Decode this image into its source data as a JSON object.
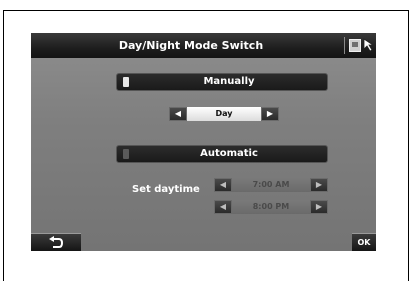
{
  "header": {
    "title": "Day/Night Mode Switch",
    "screen_icon": "screen-settings-icon",
    "cursor_icon": "back-cursor-icon"
  },
  "modes": {
    "manually_label": "Manually",
    "automatic_label": "Automatic"
  },
  "manual_spinner": {
    "value": "Day",
    "left_icon": "arrow-left-icon",
    "right_icon": "arrow-right-icon"
  },
  "daytime": {
    "label": "Set daytime",
    "start": "7:00 AM",
    "end": "8:00 PM"
  },
  "footer": {
    "back_icon": "return-arrow-icon",
    "ok_label": "OK"
  },
  "colors": {
    "active_knob": "#e8e8e8",
    "inactive_knob": "#5a5a5a"
  }
}
